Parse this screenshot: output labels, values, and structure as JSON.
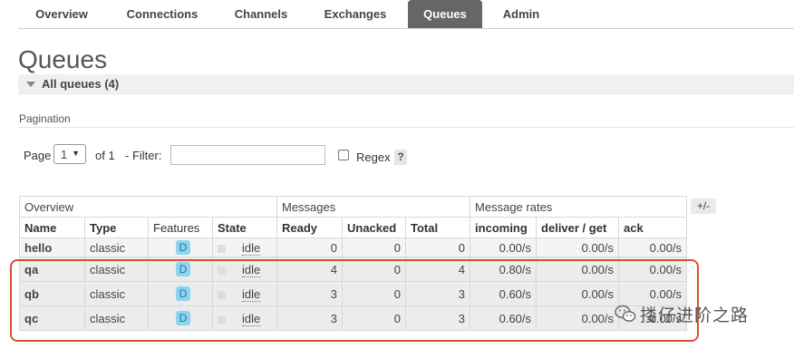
{
  "nav": {
    "tabs": [
      {
        "label": "Overview",
        "active": false
      },
      {
        "label": "Connections",
        "active": false
      },
      {
        "label": "Channels",
        "active": false
      },
      {
        "label": "Exchanges",
        "active": false
      },
      {
        "label": "Queues",
        "active": true
      },
      {
        "label": "Admin",
        "active": false
      }
    ]
  },
  "page": {
    "title": "Queues",
    "section_label": "All queues (4)",
    "pagination_label": "Pagination"
  },
  "filter": {
    "page_label": "Page",
    "page_value": "1",
    "of_label": "of 1",
    "filter_label": "- Filter:",
    "filter_value": "",
    "regex_label": "Regex",
    "regex_checked": false,
    "help_label": "?"
  },
  "table": {
    "groups": [
      "Overview",
      "Messages",
      "Message rates"
    ],
    "columns": [
      "Name",
      "Type",
      "Features",
      "State",
      "Ready",
      "Unacked",
      "Total",
      "incoming",
      "deliver / get",
      "ack"
    ],
    "toggle_label": "+/-",
    "rows": [
      {
        "name": "hello",
        "type": "classic",
        "feature": "D",
        "state": "idle",
        "ready": "0",
        "unacked": "0",
        "total": "0",
        "incoming": "0.00/s",
        "deliver_get": "0.00/s",
        "ack": "0.00/s"
      },
      {
        "name": "qa",
        "type": "classic",
        "feature": "D",
        "state": "idle",
        "ready": "4",
        "unacked": "0",
        "total": "4",
        "incoming": "0.80/s",
        "deliver_get": "0.00/s",
        "ack": "0.00/s"
      },
      {
        "name": "qb",
        "type": "classic",
        "feature": "D",
        "state": "idle",
        "ready": "3",
        "unacked": "0",
        "total": "3",
        "incoming": "0.60/s",
        "deliver_get": "0.00/s",
        "ack": "0.00/s"
      },
      {
        "name": "qc",
        "type": "classic",
        "feature": "D",
        "state": "idle",
        "ready": "3",
        "unacked": "0",
        "total": "3",
        "incoming": "0.60/s",
        "deliver_get": "0.00/s",
        "ack": "0.00/s"
      }
    ]
  },
  "annotation": {
    "highlight_color": "#d9502f",
    "watermark_icon": "wechat-icon",
    "watermark_text": "搂仔进阶之路"
  },
  "colors": {
    "active_tab": "#666666",
    "feature_badge": "#8fd3ee",
    "row_bg": "#ececec"
  }
}
